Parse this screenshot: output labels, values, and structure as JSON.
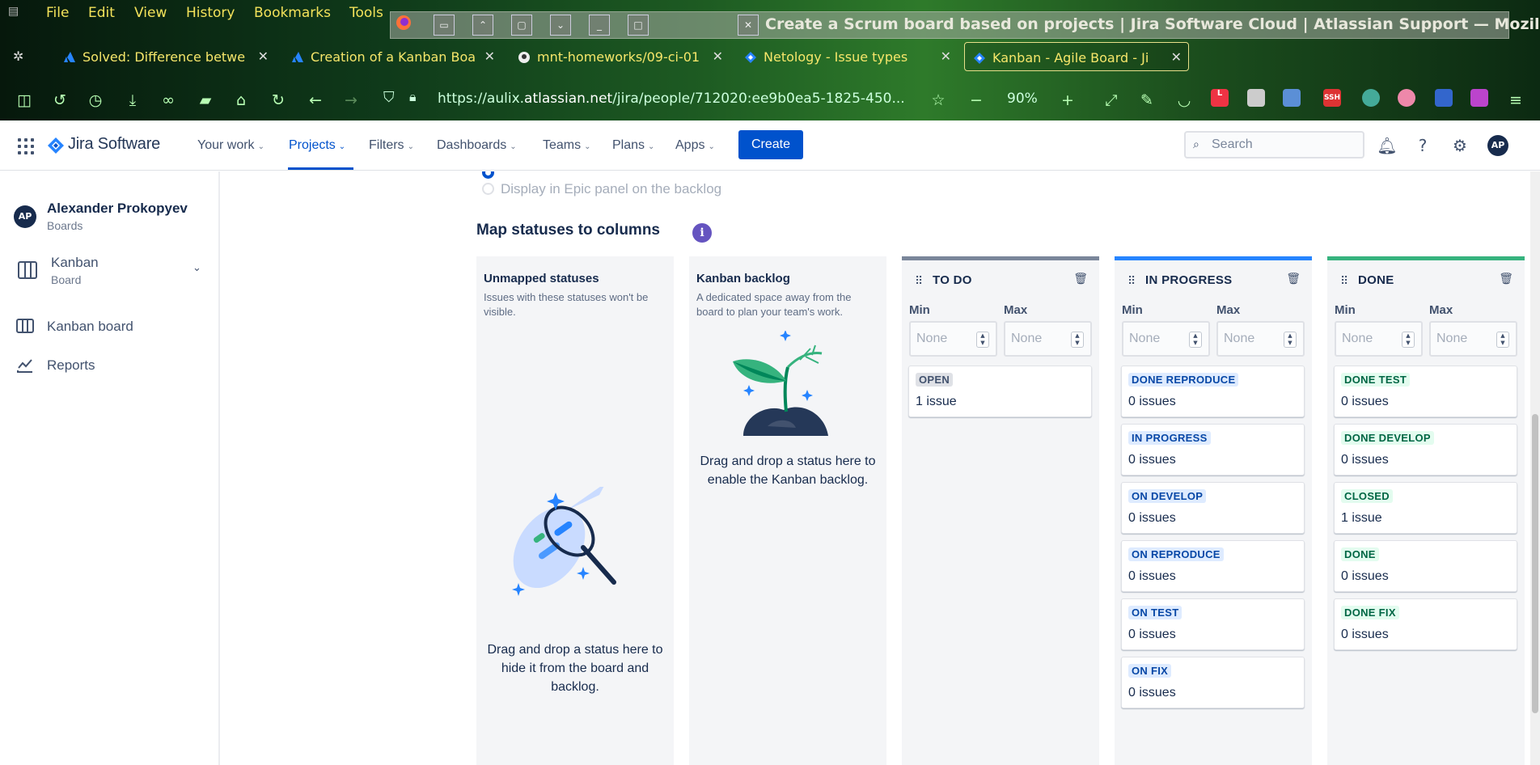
{
  "browser": {
    "menu": [
      "File",
      "Edit",
      "View",
      "History",
      "Bookmarks",
      "Tools"
    ],
    "window_title": "Create a Scrum board based on projects | Jira Software Cloud | Atlassian Support — Mozilla Fir",
    "tabs": [
      {
        "label": "Solved: Difference betwe"
      },
      {
        "label": "Creation of a Kanban Boa"
      },
      {
        "label": "mnt-homeworks/09-ci-01"
      },
      {
        "label": "Netology - Issue types"
      },
      {
        "label": "Kanban - Agile Board - Ji"
      }
    ],
    "url_prefix": "https://aulix.",
    "url_domain": "atlassian.net",
    "url_rest": "/jira/people/712020:ee9b0ea5-1825-450...",
    "zoom": "90%",
    "ssh_badge": "SSH",
    "l_badge": "L"
  },
  "jira": {
    "product": "Jira Software",
    "nav": [
      "Your work",
      "Projects",
      "Filters",
      "Dashboards",
      "Teams",
      "Plans",
      "Apps"
    ],
    "create": "Create",
    "search_placeholder": "Search",
    "avatar": "AP"
  },
  "sidebar": {
    "avatar": "AP",
    "user": "Alexander Prokopyev",
    "user_sub": "Boards",
    "board_name": "Kanban",
    "board_sub": "Board",
    "kanban_board": "Kanban board",
    "reports": "Reports"
  },
  "main": {
    "radio_epic": "Display in Epic panel on the backlog",
    "section_title": "Map statuses to columns",
    "info": "i",
    "unmapped": {
      "title": "Unmapped statuses",
      "desc": "Issues with these statuses won't be visible.",
      "msg": "Drag and drop a status here to hide it from the board and backlog."
    },
    "backlog": {
      "title": "Kanban backlog",
      "desc": "A dedicated space away from the board to plan your team's work.",
      "msg": "Drag and drop a status here to enable the Kanban backlog."
    },
    "min_label": "Min",
    "max_label": "Max",
    "none_placeholder": "None",
    "columns": [
      {
        "title": "TO DO",
        "color": "#7a869a",
        "cards": [
          {
            "label": "OPEN",
            "count": "1 issue",
            "tone": "gray"
          }
        ]
      },
      {
        "title": "IN PROGRESS",
        "color": "#2684ff",
        "cards": [
          {
            "label": "DONE REPRODUCE",
            "count": "0 issues",
            "tone": "blue"
          },
          {
            "label": "IN PROGRESS",
            "count": "0 issues",
            "tone": "blue"
          },
          {
            "label": "ON DEVELOP",
            "count": "0 issues",
            "tone": "blue"
          },
          {
            "label": "ON REPRODUCE",
            "count": "0 issues",
            "tone": "blue"
          },
          {
            "label": "ON TEST",
            "count": "0 issues",
            "tone": "blue"
          },
          {
            "label": "ON FIX",
            "count": "0 issues",
            "tone": "blue"
          }
        ]
      },
      {
        "title": "DONE",
        "color": "#36b37e",
        "cards": [
          {
            "label": "DONE TEST",
            "count": "0 issues",
            "tone": "green"
          },
          {
            "label": "DONE DEVELOP",
            "count": "0 issues",
            "tone": "green"
          },
          {
            "label": "CLOSED",
            "count": "1 issue",
            "tone": "green"
          },
          {
            "label": "DONE",
            "count": "0 issues",
            "tone": "green"
          },
          {
            "label": "DONE FIX",
            "count": "0 issues",
            "tone": "green"
          }
        ]
      }
    ]
  },
  "colors": {
    "accent": "#0052cc",
    "lozenge_blue_bg": "#deebff",
    "lozenge_blue_fg": "#0747a6",
    "lozenge_green_bg": "#e3fcef",
    "lozenge_green_fg": "#006644",
    "lozenge_gray_bg": "#dfe1e6",
    "lozenge_gray_fg": "#42526e"
  }
}
